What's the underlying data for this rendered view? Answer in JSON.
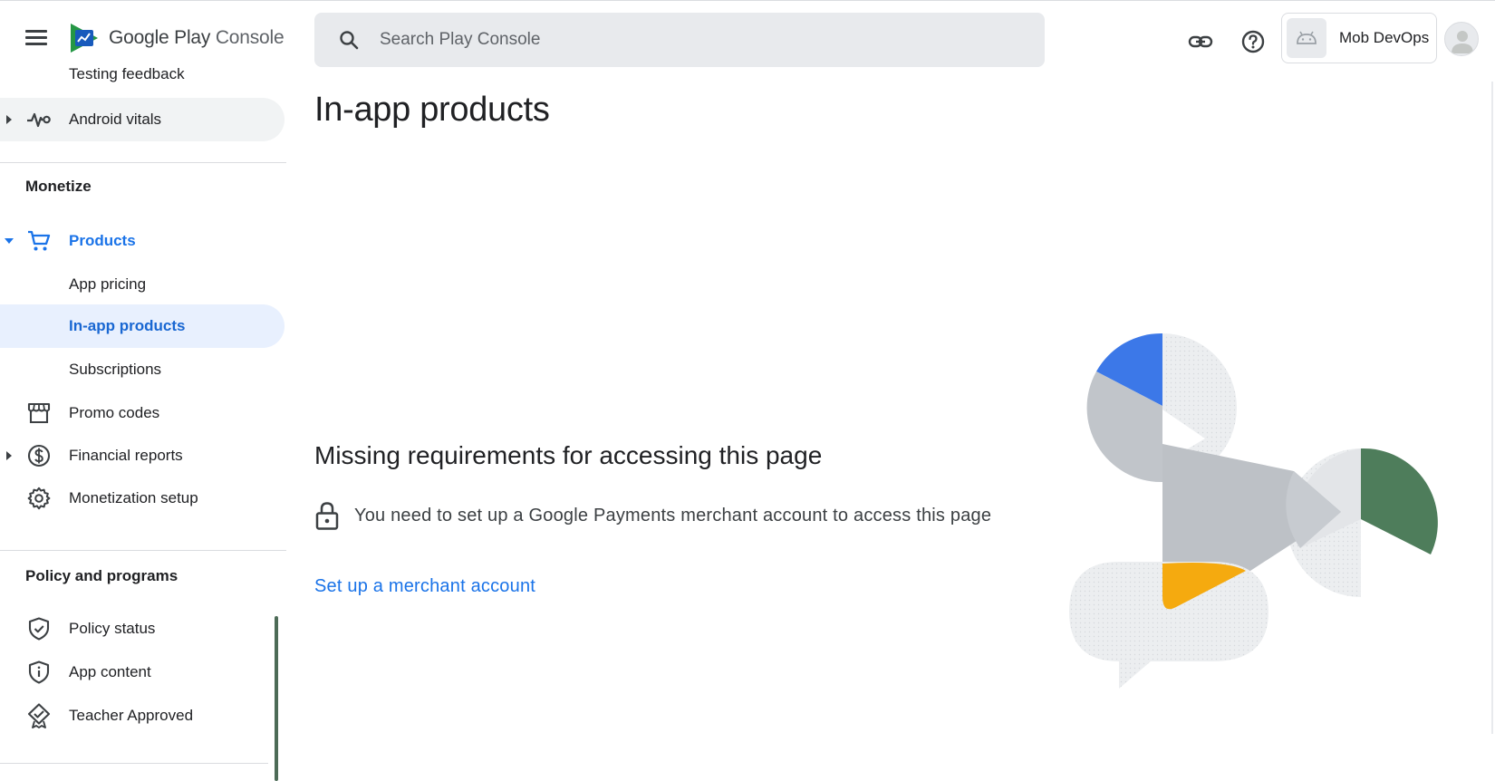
{
  "app": {
    "logo_text_brand": "Google Play",
    "logo_text_suffix": " Console"
  },
  "search": {
    "placeholder": "Search Play Console"
  },
  "account": {
    "name": "Mob DevOps"
  },
  "sidebar": {
    "partial_item": "Testing feedback",
    "android_vitals": "Android vitals",
    "monetize_section": "Monetize",
    "products": "Products",
    "app_pricing": "App pricing",
    "in_app_products": "In-app products",
    "subscriptions": "Subscriptions",
    "promo_codes": "Promo codes",
    "financial_reports": "Financial reports",
    "monetization_setup": "Monetization setup",
    "policy_section": "Policy and programs",
    "policy_status": "Policy status",
    "app_content": "App content",
    "teacher_approved": "Teacher Approved"
  },
  "main": {
    "title": "In-app products",
    "missing_title": "Missing requirements for accessing this page",
    "requirement": "You need to set up a Google Payments merchant account to access this page",
    "link": "Set up a merchant account"
  },
  "colors": {
    "accent": "#1a73e8",
    "selected_bg": "#e8f0fe",
    "search_bg": "#e8eaed",
    "illus_blue": "#3c78e8",
    "illus_green": "#4e7d5b",
    "illus_yellow": "#f5aa0f",
    "illus_gray": "#bdc1c6"
  },
  "icons": {
    "menu": "menu-icon",
    "search": "search-icon",
    "link": "link-icon",
    "help": "help-icon",
    "android": "android-icon",
    "vitals": "vitals-icon",
    "cart": "cart-icon",
    "store": "store-icon",
    "dollar": "dollar-icon",
    "gear": "gear-icon",
    "shield": "shield-check-icon",
    "info_shield": "shield-info-icon",
    "badge": "badge-check-icon",
    "lock": "lock-icon"
  }
}
